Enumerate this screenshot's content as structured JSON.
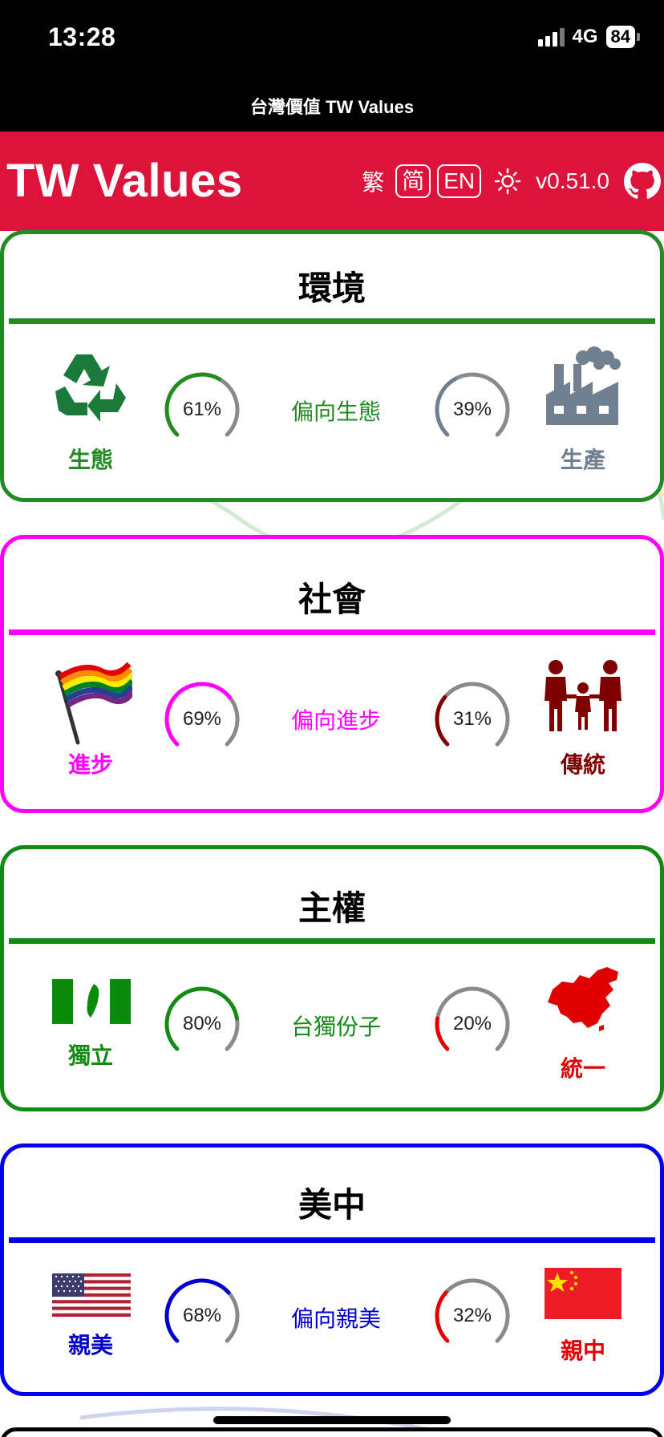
{
  "status": {
    "time": "13:28",
    "network": "4G",
    "battery": "84"
  },
  "page_title": "台灣價值 TW Values",
  "header": {
    "brand": "TW Values",
    "lang_trad": "繁",
    "lang_simp": "简",
    "lang_en": "EN",
    "version": "v0.51.0",
    "icons": [
      "sun-icon",
      "github-icon"
    ]
  },
  "cards": [
    {
      "title": "環境",
      "color": "#228b22",
      "left_label": "生態",
      "left_color": "#228b22",
      "left_pct": 61,
      "left_text": "61%",
      "left_icon": "recycle-icon",
      "right_label": "生產",
      "right_color": "#708090",
      "right_pct": 39,
      "right_text": "39%",
      "right_icon": "factory-icon",
      "verdict": "偏向生態",
      "verdict_color": "#228b22"
    },
    {
      "title": "社會",
      "color": "#ff00ff",
      "left_label": "進步",
      "left_color": "#ff00ff",
      "left_pct": 69,
      "left_text": "69%",
      "left_icon": "rainbow-flag-icon",
      "right_label": "傳統",
      "right_color": "#800000",
      "right_pct": 31,
      "right_text": "31%",
      "right_icon": "family-icon",
      "verdict": "偏向進步",
      "verdict_color": "#ff00ff"
    },
    {
      "title": "主權",
      "color": "#138a13",
      "left_label": "獨立",
      "left_color": "#138a13",
      "left_pct": 80,
      "left_text": "80%",
      "left_icon": "taiwan-flag-icon",
      "right_label": "統一",
      "right_color": "#e00000",
      "right_pct": 20,
      "right_text": "20%",
      "right_icon": "china-map-icon",
      "verdict": "台獨份子",
      "verdict_color": "#138a13"
    },
    {
      "title": "美中",
      "color": "#0000ee",
      "left_label": "親美",
      "left_color": "#0000cc",
      "left_pct": 68,
      "left_text": "68%",
      "left_icon": "us-flag-icon",
      "right_label": "親中",
      "right_color": "#e00000",
      "right_pct": 32,
      "right_text": "32%",
      "right_icon": "prc-flag-icon",
      "verdict": "偏向親美",
      "verdict_color": "#0000cc"
    }
  ]
}
